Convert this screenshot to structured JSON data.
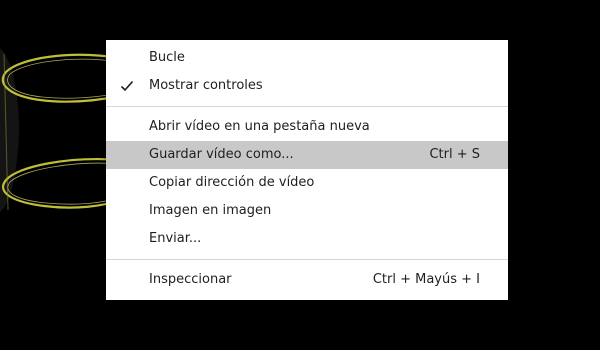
{
  "context_menu": {
    "items": [
      {
        "label": "Bucle",
        "checked": false,
        "shortcut": ""
      },
      {
        "label": "Mostrar controles",
        "checked": true,
        "shortcut": ""
      },
      {
        "label": "Abrir vídeo en una pestaña nueva",
        "checked": false,
        "shortcut": ""
      },
      {
        "label": "Guardar vídeo como...",
        "checked": false,
        "shortcut": "Ctrl + S",
        "highlighted": true
      },
      {
        "label": "Copiar dirección de vídeo",
        "checked": false,
        "shortcut": ""
      },
      {
        "label": "Imagen en imagen",
        "checked": false,
        "shortcut": ""
      },
      {
        "label": "Enviar...",
        "checked": false,
        "shortcut": ""
      },
      {
        "label": "Inspeccionar",
        "checked": false,
        "shortcut": "Ctrl + Mayús + I"
      }
    ]
  },
  "colors": {
    "background": "#000000",
    "menu_background": "#ffffff",
    "highlight": "#c8c8c8",
    "text": "#1f1f1f",
    "video_swirl": "#c8c83c"
  },
  "icons": {
    "checkmark": "checkmark-icon"
  }
}
